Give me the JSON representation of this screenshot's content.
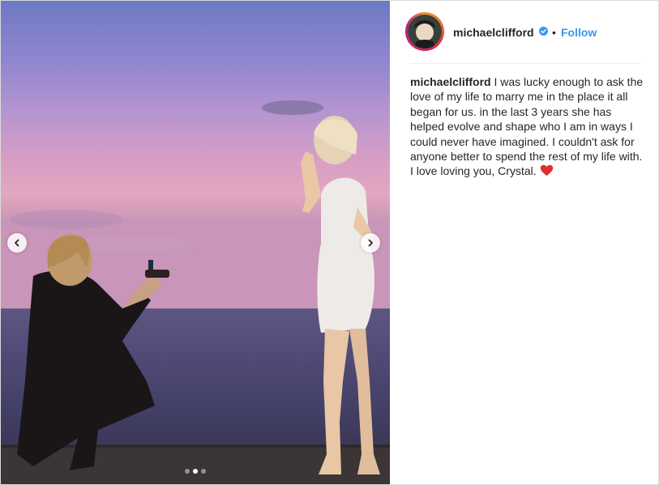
{
  "post": {
    "username": "michaelclifford",
    "separator": "•",
    "follow_label": "Follow",
    "caption_text": "I was lucky enough to ask the love of my life to marry me in the place it all began for us. in the last 3 years she has helped evolve and shape who I am in ways I could never have imagined. I couldn't ask for anyone better to spend the rest of my life with. I love loving you, Crystal.",
    "caption_emoji": "red-heart-emoji"
  },
  "carousel": {
    "slide_count": 3,
    "active_index": 2
  },
  "icons": {
    "prev": "chevron-left-icon",
    "next": "chevron-right-icon",
    "verified": "verified-badge-icon"
  },
  "colors": {
    "follow": "#3897f0",
    "verified": "#3897f0",
    "text": "#262626",
    "heart": "#e0302b"
  }
}
